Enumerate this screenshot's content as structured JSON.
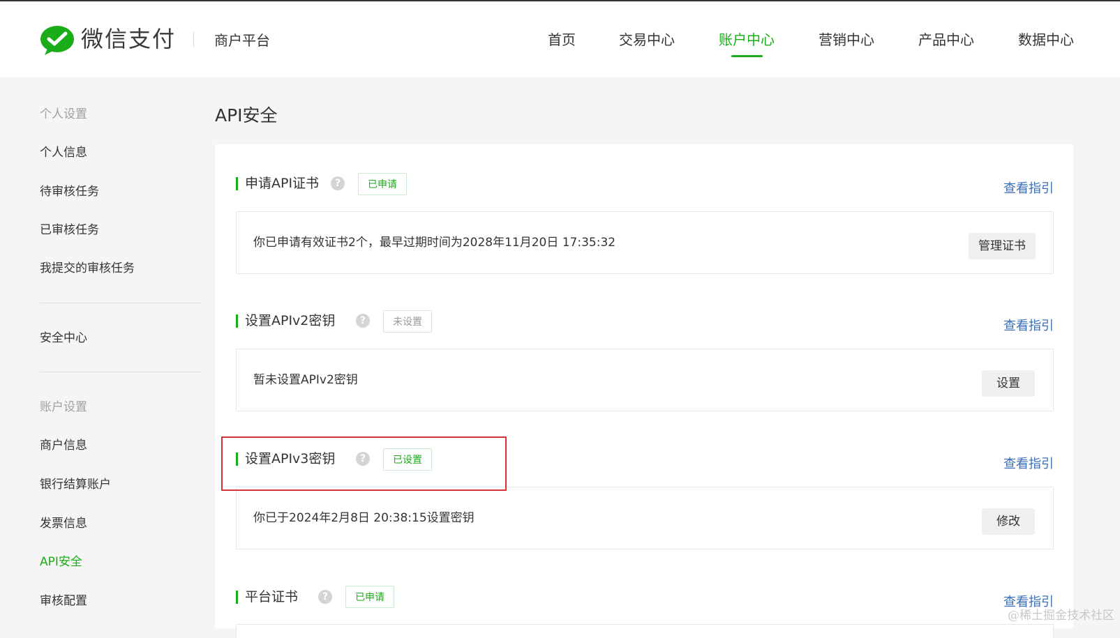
{
  "header": {
    "logo_text": "微信支付",
    "platform": "商户平台",
    "nav": [
      "首页",
      "交易中心",
      "账户中心",
      "营销中心",
      "产品中心",
      "数据中心"
    ],
    "active_nav": "账户中心"
  },
  "sidebar": {
    "group_personal": "个人设置",
    "personal_items": [
      "个人信息",
      "待审核任务",
      "已审核任务",
      "我提交的审核任务"
    ],
    "security_center": "安全中心",
    "group_account": "账户设置",
    "account_items": [
      "商户信息",
      "银行结算账户",
      "发票信息",
      "API安全",
      "审核配置"
    ],
    "active_item": "API安全"
  },
  "main": {
    "title": "API安全",
    "help_glyph": "?",
    "sections": [
      {
        "title": "申请API证书",
        "badge": "已申请",
        "guide": "查看指引",
        "text": "你已申请有效证书2个，最早过期时间为2028年11月20日 17:35:32",
        "button": "管理证书"
      },
      {
        "title": "设置APIv2密钥",
        "badge": "未设置",
        "guide": "查看指引",
        "text": "暂未设置APIv2密钥",
        "button": "设置"
      },
      {
        "title": "设置APIv3密钥",
        "badge": "已设置",
        "guide": "查看指引",
        "text": "你已于2024年2月8日 20:38:15设置密钥",
        "button": "修改"
      },
      {
        "title": "平台证书",
        "badge": "已申请",
        "guide": "查看指引"
      }
    ]
  },
  "watermark": "@稀土掘金技术社区",
  "colors": {
    "accent": "#1aad19",
    "link": "#3a6fb8",
    "highlight": "#d9323a"
  }
}
